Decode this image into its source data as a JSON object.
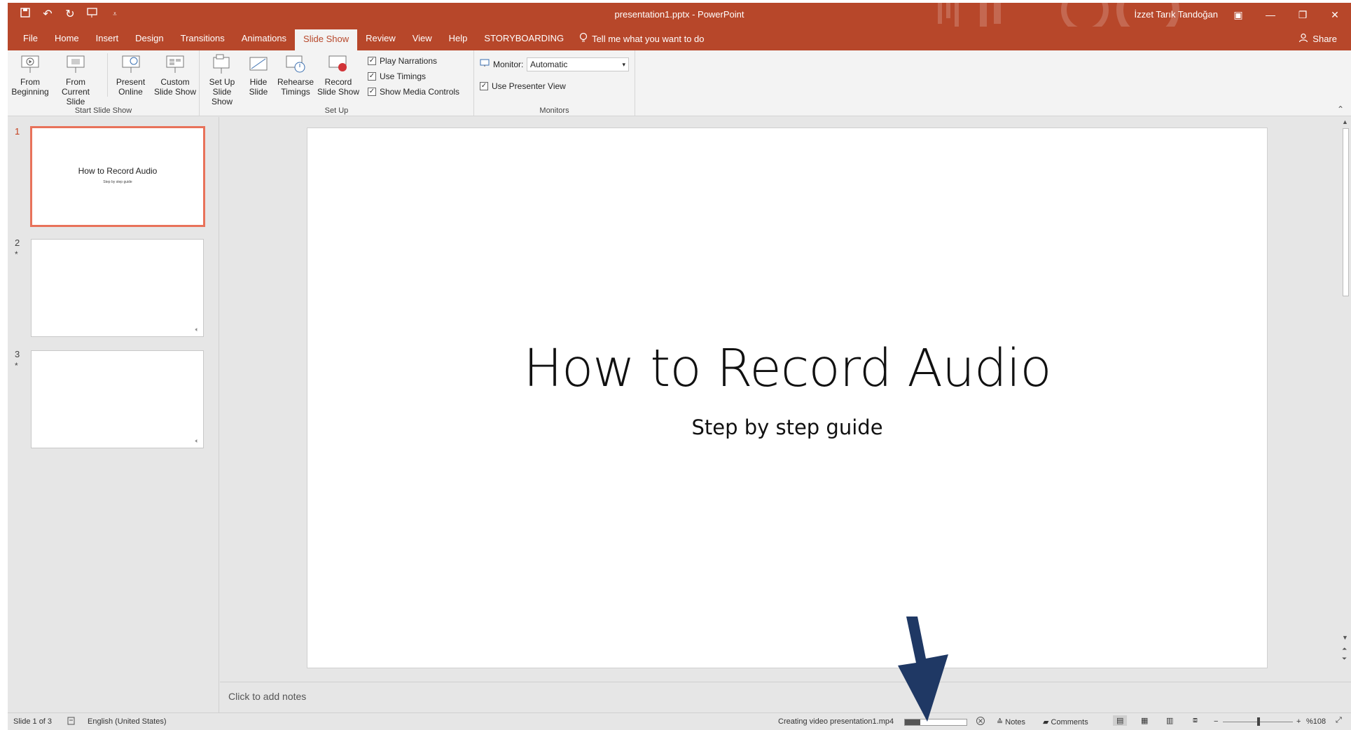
{
  "app": {
    "doc_title": "presentation1.pptx  -  PowerPoint",
    "user": "İzzet Tarık Tandoğan",
    "accent": "#b7472a"
  },
  "qat": {
    "icons": [
      "save-icon",
      "undo-icon",
      "redo-icon",
      "start-from-beginning-icon",
      "customize-qat-icon"
    ]
  },
  "tabs": [
    "File",
    "Home",
    "Insert",
    "Design",
    "Transitions",
    "Animations",
    "Slide Show",
    "Review",
    "View",
    "Help",
    "STORYBOARDING"
  ],
  "active_tab": "Slide Show",
  "tell_me": "Tell me what you want to do",
  "share": "Share",
  "ribbon": {
    "start": {
      "label": "Start Slide Show",
      "from_beginning": "From Beginning",
      "from_current": "From Current Slide",
      "present_online": "Present Online",
      "custom_show": "Custom Slide Show"
    },
    "setup": {
      "label": "Set Up",
      "setup_show": "Set Up Slide Show",
      "hide_slide": "Hide Slide",
      "rehearse": "Rehearse Timings",
      "record": "Record Slide Show",
      "play_narrations": "Play Narrations",
      "use_timings": "Use Timings",
      "show_media": "Show Media Controls"
    },
    "monitors": {
      "label": "Monitors",
      "monitor_label": "Monitor:",
      "monitor_value": "Automatic",
      "presenter_view": "Use Presenter View"
    }
  },
  "thumbnails": [
    {
      "number": "1",
      "title": "How to Record Audio",
      "subtitle": "Step by step guide"
    },
    {
      "number": "2",
      "star": "*"
    },
    {
      "number": "3",
      "star": "*"
    }
  ],
  "slide": {
    "title": "How to Record Audio",
    "subtitle": "Step by step guide"
  },
  "notes_placeholder": "Click to add notes",
  "status": {
    "slide_count": "Slide 1 of 3",
    "language": "English (United States)",
    "creating_video": "Creating video presentation1.mp4",
    "progress": 0.25,
    "notes": "Notes",
    "comments": "Comments",
    "zoom": "%108"
  },
  "annotation_color": "#1f3864"
}
